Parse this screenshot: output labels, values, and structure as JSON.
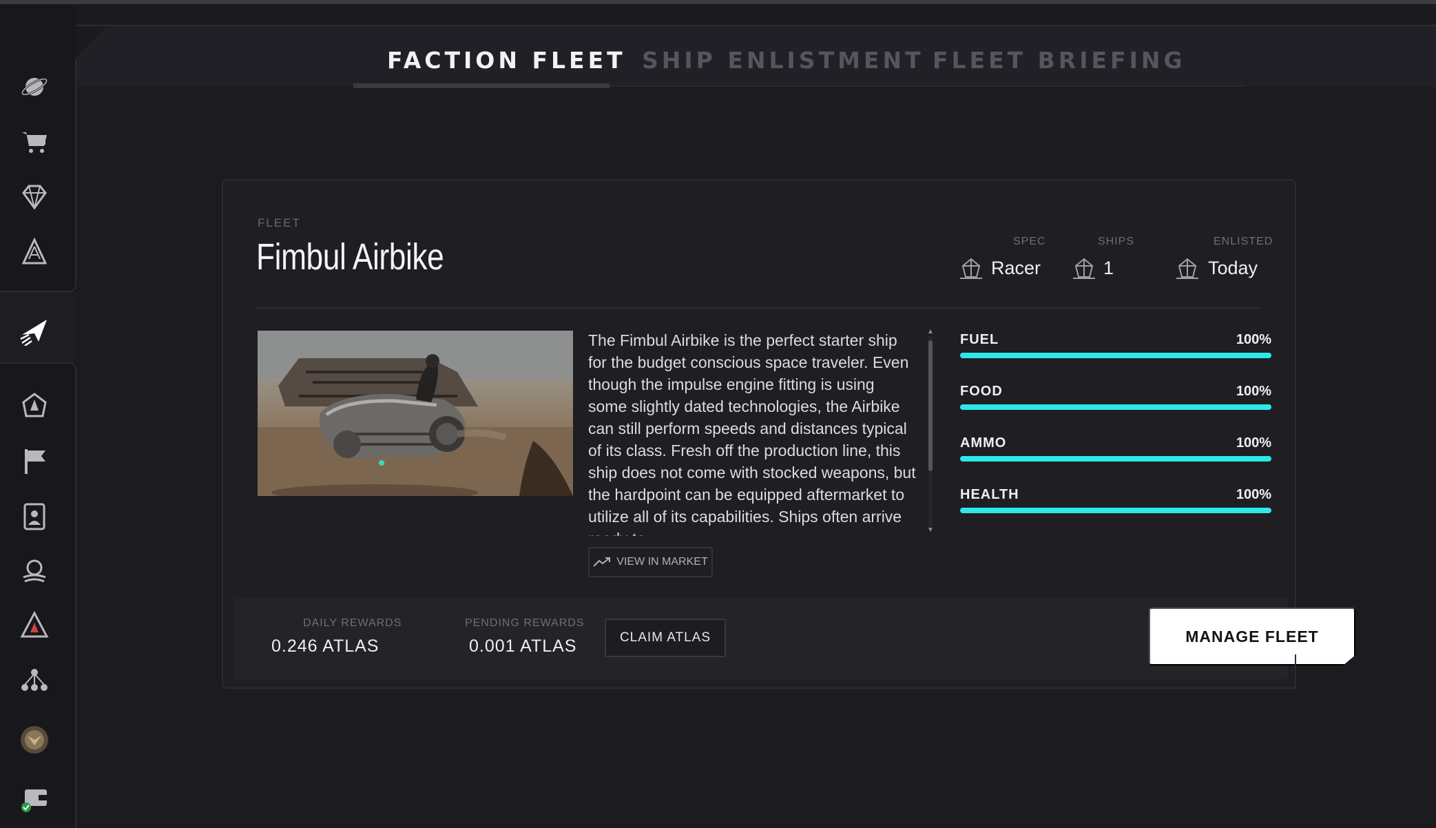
{
  "colors": {
    "background": "#1a1a1f",
    "accent_bar": "#2ee8e8",
    "manage_button_bg": "#ffffff"
  },
  "sidebar": {
    "items": [
      {
        "icon": "planet-icon"
      },
      {
        "icon": "cart-icon"
      },
      {
        "icon": "diamond-icon"
      },
      {
        "icon": "atlas-logo-icon"
      },
      {
        "icon": "paper-plane-icon",
        "active": true
      },
      {
        "icon": "faction-crest-icon"
      },
      {
        "icon": "flag-icon"
      },
      {
        "icon": "badge-card-icon"
      },
      {
        "icon": "swirl-emblem-icon"
      },
      {
        "icon": "faction-emblem-icon"
      },
      {
        "icon": "network-icon"
      },
      {
        "icon": "avatar-medal-icon"
      },
      {
        "icon": "wallet-icon",
        "status": "connected"
      }
    ]
  },
  "tabs": [
    {
      "label": "FACTION FLEET",
      "active": true
    },
    {
      "label": "SHIP ENLISTMENT",
      "active": false
    },
    {
      "label": "FLEET BRIEFING",
      "active": false
    }
  ],
  "fleet": {
    "label": "FLEET",
    "name": "Fimbul Airbike",
    "stats": [
      {
        "head": "SPEC",
        "value": "Racer",
        "icon": "ship-outline-icon"
      },
      {
        "head": "SHIPS",
        "value": "1",
        "icon": "ship-outline-icon"
      },
      {
        "head": "ENLISTED",
        "value": "Today",
        "icon": "ship-outline-icon"
      }
    ],
    "description": "The Fimbul Airbike is the perfect starter ship for the budget conscious space traveler. Even though the impulse engine fitting is using some slightly dated technologies, the Airbike can still perform speeds and distances typical of its class. Fresh off the production line, this ship does not come with stocked weapons, but the hardpoint can be equipped aftermarket to utilize all of its capabilities. Ships often arrive ready to",
    "market_button": "VIEW IN MARKET",
    "resources": [
      {
        "label": "FUEL",
        "pct": "100%",
        "fraction": 1.0
      },
      {
        "label": "FOOD",
        "pct": "100%",
        "fraction": 1.0
      },
      {
        "label": "AMMO",
        "pct": "100%",
        "fraction": 1.0
      },
      {
        "label": "HEALTH",
        "pct": "100%",
        "fraction": 1.0
      }
    ]
  },
  "rewards": {
    "daily_head": "DAILY REWARDS",
    "daily_value": "0.246 ATLAS",
    "pending_head": "PENDING REWARDS",
    "pending_value": "0.001 ATLAS",
    "claim_label": "CLAIM ATLAS",
    "manage_label": "MANAGE FLEET"
  }
}
